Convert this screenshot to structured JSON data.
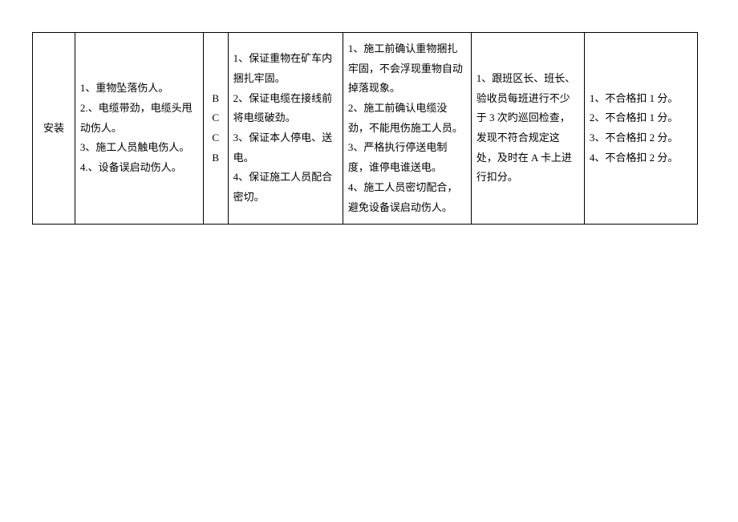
{
  "table": {
    "row": {
      "col1": "安装",
      "col2": {
        "items": [
          "1、重物坠落伤人。",
          "2.、电缆带劲，电缆头甩动伤人。",
          "3、施工人员触电伤人。",
          "4.、设备误启动伤人。"
        ]
      },
      "col3": {
        "items": [
          "B",
          "C",
          "",
          "C",
          "",
          "B"
        ]
      },
      "col4": {
        "items": [
          "1、保证重物在矿车内捆扎牢固。",
          "2、保证电缆在接线前将电缆破劲。",
          "3、保证本人停电、送电。",
          "4、保证施工人员配合密切。"
        ]
      },
      "col5": {
        "items": [
          "1、施工前确认重物捆扎牢固，不会浮现重物自动掉落现象。",
          "2、施工前确认电缆没劲，不能甩伤施工人员。",
          "3、严格执行停送电制度，谁停电谁送电。",
          "4、施工人员密切配合，避免设备误启动伤人。"
        ]
      },
      "col6": "1、跟班区长、班长、验收员每班进行不少于 3 次旳巡回检查，发现不符合规定这处，及时在 A 卡上进行扣分。",
      "col7": {
        "items": [
          "1、不合格扣 1 分。",
          "",
          "2、不合格扣 1 分。",
          "",
          "",
          "3、不合格扣 2 分。",
          "",
          "",
          "4、不合格扣 2 分。"
        ]
      }
    }
  }
}
